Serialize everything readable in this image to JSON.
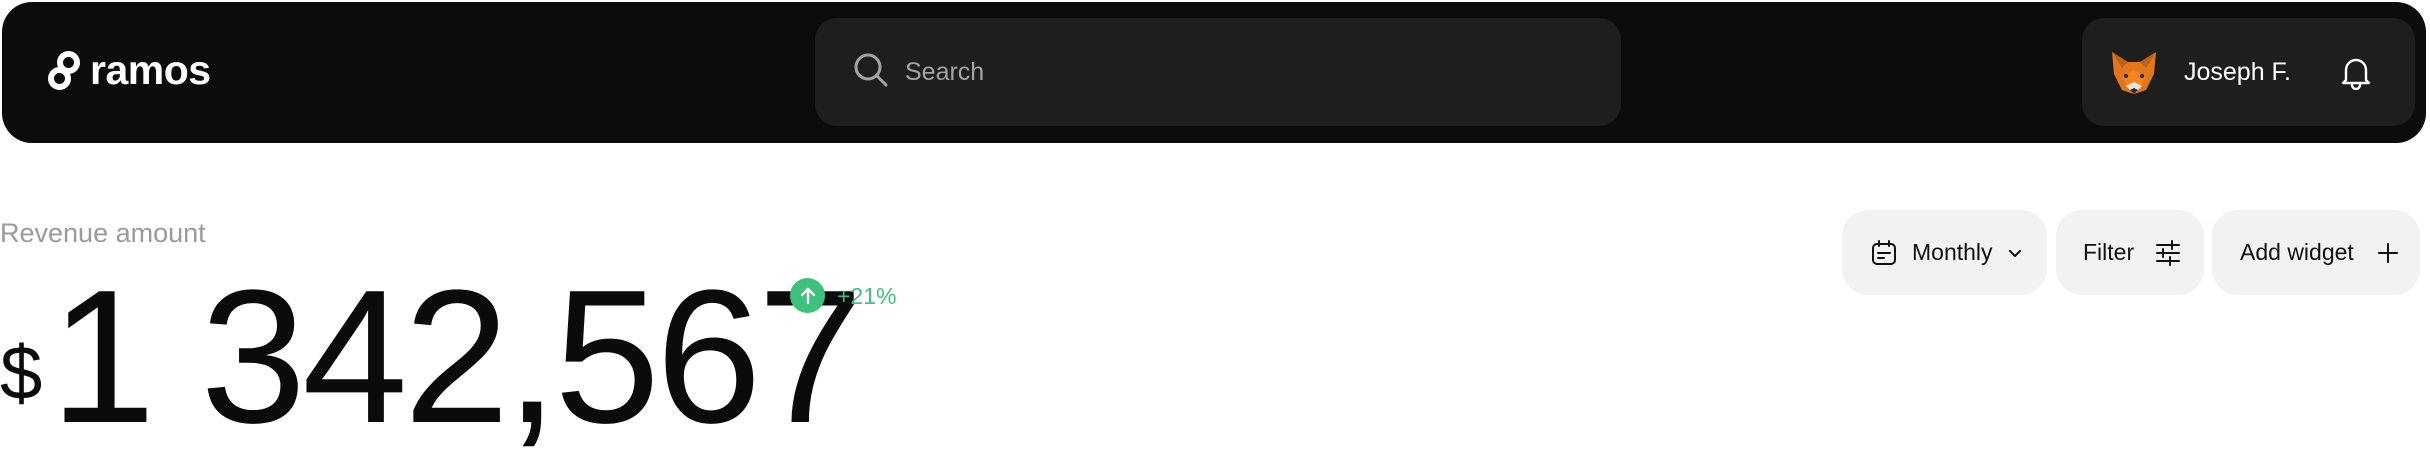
{
  "header": {
    "brand": "ramos",
    "search": {
      "placeholder": "Search",
      "value": ""
    },
    "user": {
      "name": "Joseph F."
    }
  },
  "revenue": {
    "label": "Revenue amount",
    "currency": "$",
    "amount": "1 342,567",
    "change": "+21%"
  },
  "controls": {
    "period": "Monthly",
    "filter": "Filter",
    "add_widget": "Add widget"
  },
  "colors": {
    "topbar": "#0c0c0c",
    "field": "#1e1e1e",
    "positive": "#3cc27c",
    "pill": "#f2f2f2"
  },
  "icons": [
    "chain-link-logo-icon",
    "search-icon",
    "fox-avatar",
    "bell-icon",
    "arrow-up-icon",
    "calendar-icon",
    "chevron-down-icon",
    "sliders-icon",
    "plus-icon"
  ]
}
